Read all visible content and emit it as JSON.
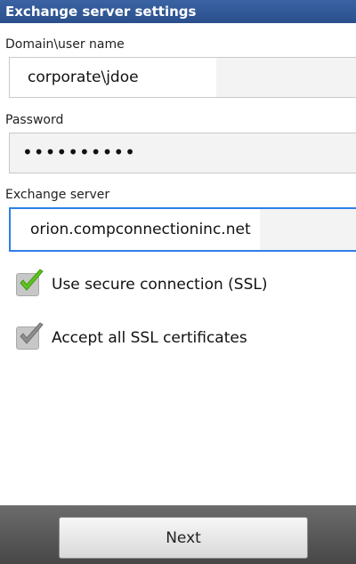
{
  "title_bar": {
    "title": "Exchange server settings"
  },
  "form": {
    "domain_label": "Domain\\user name",
    "domain_value": "corporate\\jdoe",
    "password_label": "Password",
    "password_value": "••••••••••",
    "server_label": "Exchange server",
    "server_value": "orion.compconnectioninc.net"
  },
  "options": [
    {
      "label": "Use secure connection (SSL)",
      "checked": true,
      "check_color": "#5fc21e"
    },
    {
      "label": "Accept all SSL certificates",
      "checked": true,
      "check_color": "#8e8e8e"
    }
  ],
  "footer": {
    "next_label": "Next"
  }
}
